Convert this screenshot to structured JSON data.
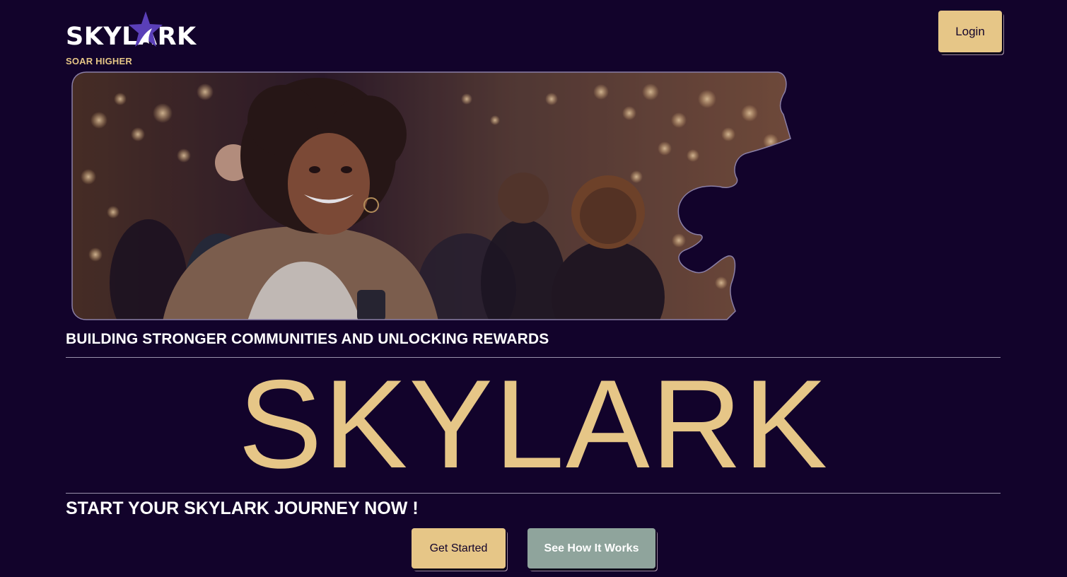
{
  "brand": {
    "logo_text": "SKYLARK",
    "tagline": "SOAR HIGHER"
  },
  "header": {
    "login_label": "Login"
  },
  "hero": {
    "headline": "BUILDING STRONGER COMMUNITIES AND UNLOCKING REWARDS",
    "big_title": "SKYLARK",
    "cta_title": "START YOUR SKYLARK JOURNEY NOW !",
    "image_subject": "smiling-woman-crowd-bokeh-photo"
  },
  "actions": {
    "get_started_label": "Get Started",
    "how_it_works_label": "See How It Works"
  },
  "colors": {
    "background": "#12032b",
    "accent_gold": "#e6c687",
    "secondary_button": "#8fa49c",
    "logo_star": "#5a3fb8"
  }
}
